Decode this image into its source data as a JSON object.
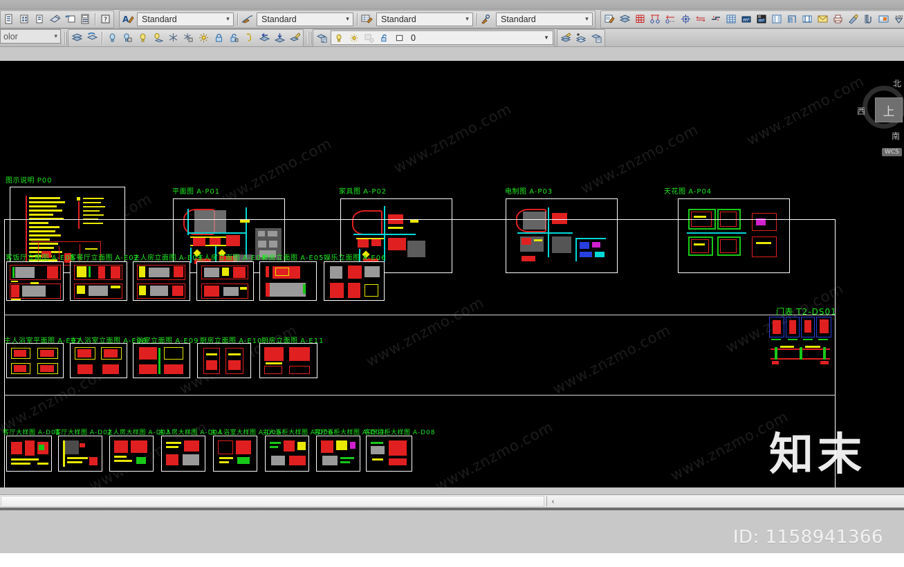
{
  "app": {
    "title": "AutoCAD drawing workspace",
    "accent": "#1ee81e",
    "canvas_bg": "#000000"
  },
  "toolbars": {
    "style_combos": [
      {
        "name": "text-style",
        "value": "Standard",
        "icon": "text-style-icon"
      },
      {
        "name": "dimension-style",
        "value": "Standard",
        "icon": "dimension-style-icon"
      },
      {
        "name": "table-style",
        "value": "Standard",
        "icon": "table-style-icon"
      },
      {
        "name": "multileader-style",
        "value": "Standard",
        "icon": "multileader-style-icon"
      }
    ],
    "row1_left_icons": [
      "new-drawing-icon",
      "open-drawing-icon",
      "save-drawing-icon",
      "plot-icon",
      "plot-preview-icon",
      "calculator-icon",
      "help-icon"
    ],
    "row1_right_icons": [
      "edit-attribute-icon",
      "layers-icon",
      "grid-icon",
      "columns-icon",
      "column-line-icon",
      "node-icon",
      "align-icon",
      "offset-section-icon",
      "table-icon",
      "area-m2-icon",
      "area-list-icon",
      "wall-icon",
      "door-icon",
      "window-icon",
      "mail-icon",
      "print-icon",
      "paint-icon",
      "clip-icon",
      "image-icon",
      "elevation-icon",
      "list-icon",
      "text-icon",
      "target-icon",
      "info-icon"
    ],
    "row2_icons": [
      "layer-properties-icon",
      "layer-previous-icon",
      "layer-on-icon",
      "layer-off-icon",
      "layer-lamp-icon",
      "layer-lamp2-icon",
      "layer-freeze-icon",
      "layer-thaw-icon",
      "layer-sun-icon",
      "layer-lock-icon",
      "layer-unlock-icon",
      "layer-isolate-icon",
      "layer-merge-icon",
      "layer-to-current-icon",
      "layer-match-icon"
    ],
    "row2_tail_icons": [
      "layer-walk-icon",
      "layer-new-icon",
      "layer-states-icon"
    ],
    "color_control": {
      "name": "color-control",
      "value": "olor",
      "arrow": "⌄"
    },
    "layer_control": {
      "name": "layer-control",
      "value": "0",
      "icons": [
        "lightbulb-icon",
        "sun-icon",
        "freeze-icon",
        "unlock-icon",
        "color-swatch-icon"
      ],
      "arrow": "⌄"
    }
  },
  "viewcube": {
    "face_label": "上",
    "north": "北",
    "west": "西",
    "south": "南",
    "ucs_label": "WCS"
  },
  "drawings": {
    "plan_row": [
      {
        "label": "图示说明",
        "code": "P00",
        "kind": "legend"
      },
      {
        "label": "平面图",
        "code": "A-P01",
        "kind": "plan"
      },
      {
        "label": "家具图",
        "code": "A-P02",
        "kind": "plan"
      },
      {
        "label": "电制图",
        "code": "A-P03",
        "kind": "plan"
      },
      {
        "label": "天花图",
        "code": "A-P04",
        "kind": "plan"
      }
    ],
    "elevation_row1": [
      {
        "label": "客饭厅立面图",
        "code": "A-E01"
      },
      {
        "label": "客餐厅立面图",
        "code": "A-E02"
      },
      {
        "label": "主人房立面图",
        "code": "A-E03"
      },
      {
        "label": "主人房立面图",
        "code": "A-E04"
      },
      {
        "label": "神房立面图",
        "code": "A-E05"
      },
      {
        "label": "娱乐立面图",
        "code": "A-E06"
      }
    ],
    "elevation_row2": [
      {
        "label": "主人浴室平面图",
        "code": "A-E07"
      },
      {
        "label": "主人浴室立面图",
        "code": "A-E08"
      },
      {
        "label": "浴室立面图",
        "code": "A-E09"
      },
      {
        "label": "厨房立面图",
        "code": "A-E10"
      },
      {
        "label": "厨房立面图",
        "code": "A-E11"
      }
    ],
    "detail_row": [
      {
        "label": "客厅大样图",
        "code": "A-D01"
      },
      {
        "label": "客厅大样图",
        "code": "A-D02"
      },
      {
        "label": "主人房大样图",
        "code": "A-D03"
      },
      {
        "label": "主人房大样图",
        "code": "A-D04"
      },
      {
        "label": "主人浴室大样图",
        "code": "A-D05"
      },
      {
        "label": "主人浴柜大样图",
        "code": "A-D06"
      },
      {
        "label": "客厅浴柜大样图",
        "code": "A-D07"
      },
      {
        "label": "客厅浴柜大样图",
        "code": "A-D08"
      }
    ],
    "door_schedule": {
      "label": "门表",
      "code": "T2-DS01"
    }
  },
  "scrollbar": {
    "left_arrow": "‹"
  },
  "watermark": {
    "brand": "知末",
    "id_text": "ID: 1158941366",
    "tile_text": "www.znzmo.com"
  }
}
